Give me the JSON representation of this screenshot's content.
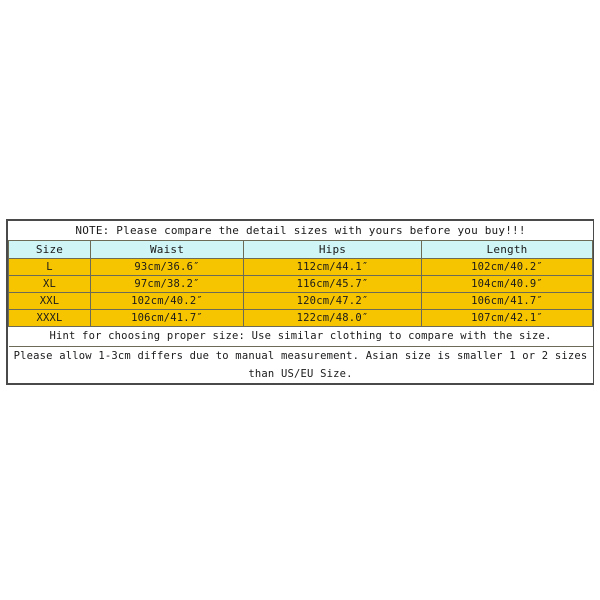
{
  "chart_data": {
    "type": "table",
    "title": "NOTE: Please compare the detail sizes with yours before you buy!!!",
    "columns": [
      "Size",
      "Waist",
      "Hips",
      "Length"
    ],
    "rows": [
      [
        "L",
        "93cm/36.6″",
        "112cm/44.1″",
        "102cm/40.2″"
      ],
      [
        "XL",
        "97cm/38.2″",
        "116cm/45.7″",
        "104cm/40.9″"
      ],
      [
        "XXL",
        "102cm/40.2″",
        "120cm/47.2″",
        "106cm/41.7″"
      ],
      [
        "XXXL",
        "106cm/41.7″",
        "122cm/48.0″",
        "107cm/42.1″"
      ]
    ],
    "notes": [
      "Hint for choosing proper size: Use similar clothing to compare with the size.",
      "Please allow 1-3cm differs due to manual measurement. Asian size is smaller 1 or 2 sizes than US/EU Size."
    ],
    "colors": {
      "header_background": "#cff5f7",
      "data_background": "#f7c500",
      "note_background": "#ffffff",
      "border": "#6b6b57",
      "outer_border": "#4a4a4a",
      "text": "#1a1a1a",
      "page_background": "#ffffff"
    }
  },
  "table": {
    "note_banner": "NOTE: Please compare the detail sizes with yours before you buy!!!",
    "headers": {
      "size": "Size",
      "waist": "Waist",
      "hips": "Hips",
      "length": "Length"
    },
    "rows": [
      {
        "size": "L",
        "waist": "93cm/36.6″",
        "hips": "112cm/44.1″",
        "length": "102cm/40.2″"
      },
      {
        "size": "XL",
        "waist": "97cm/38.2″",
        "hips": "116cm/45.7″",
        "length": "104cm/40.9″"
      },
      {
        "size": "XXL",
        "waist": "102cm/40.2″",
        "hips": "120cm/47.2″",
        "length": "106cm/41.7″"
      },
      {
        "size": "XXXL",
        "waist": "106cm/41.7″",
        "hips": "122cm/48.0″",
        "length": "107cm/42.1″"
      }
    ],
    "hint": "Hint for choosing proper size: Use similar clothing to compare with the size.",
    "disclaimer": "Please allow 1-3cm differs due to manual measurement. Asian size is smaller 1 or 2 sizes than US/EU Size."
  }
}
